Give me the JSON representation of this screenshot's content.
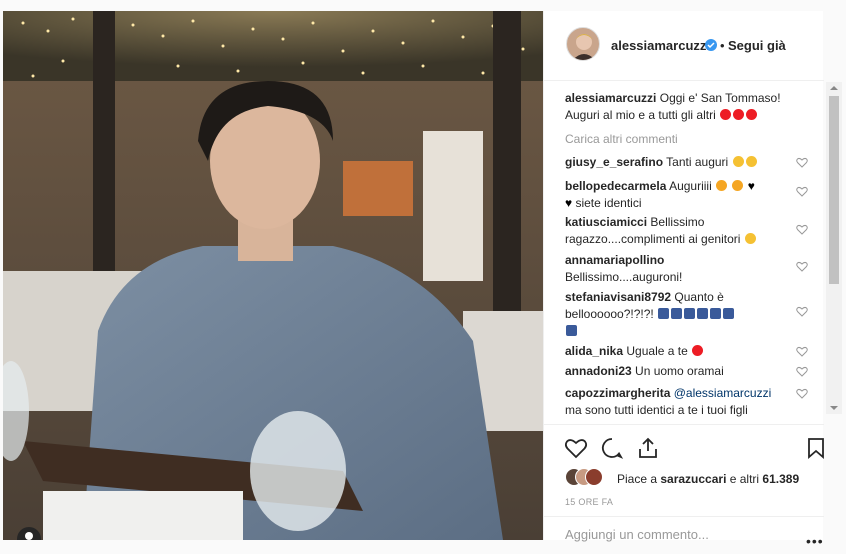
{
  "post": {
    "username": "alessiamarcuzzi",
    "separator": "•",
    "follow_label": "Segui già"
  },
  "caption": {
    "username": "alessiamarcuzzi",
    "text": "Oggi e' San Tommaso! Auguri al mio e a tutti gli altri"
  },
  "load_more_label": "Carica altri commenti",
  "comments": [
    {
      "user": "giusy_e_serafino",
      "text": "Tanti auguri"
    },
    {
      "user": "bellopedecarmela",
      "text": "Auguriiii",
      "text2": "siete identici"
    },
    {
      "user": "katiusciamicci",
      "text": "Bellissimo",
      "text2": "ragazzo....complimenti ai genitori"
    },
    {
      "user": "annamariapollino",
      "text2": "Bellissimo....auguroni!"
    },
    {
      "user": "stefaniavisani8792",
      "text": "Quanto è",
      "text2": "belloooooo?!?!?!"
    },
    {
      "user": "alida_nika",
      "text": "Uguale a te"
    },
    {
      "user": "annadoni23",
      "text": "Un uomo oramai"
    },
    {
      "user": "capozzimargherita",
      "mention": "@alessiamarcuzzi",
      "text2": "ma sono tutti identici a te i tuoi figli"
    }
  ],
  "likes": {
    "prefix": "Piace a ",
    "user": "sarazuccari",
    "suffix": " e altri ",
    "count": "61.389"
  },
  "time_label": "15 ORE FA",
  "add_comment_placeholder": "Aggiungi un commento...",
  "more_label": "•••",
  "colors": {
    "accent": "#3897f0",
    "heart": "#ed1c24",
    "muted": "#999999",
    "text": "#262626"
  },
  "icons": [
    "verified-icon",
    "heart-icon",
    "comment-icon",
    "share-icon",
    "bookmark-icon",
    "user-icon"
  ]
}
